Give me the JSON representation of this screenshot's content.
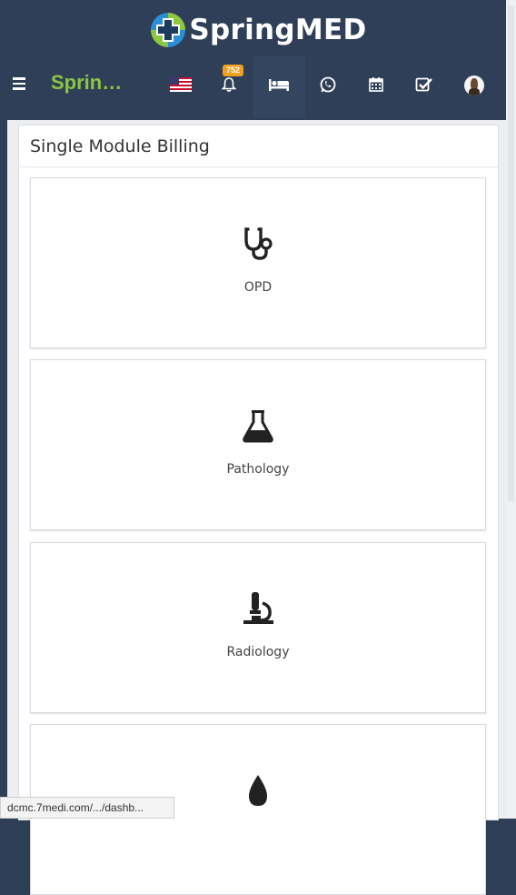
{
  "header": {
    "logo_text": "SpringMED",
    "brand_short": "Sprin…",
    "notification_count": "752",
    "icons": [
      "us-flag-icon",
      "bell-icon",
      "bed-icon",
      "whatsapp-icon",
      "calendar-icon",
      "check-square-icon",
      "user-avatar"
    ]
  },
  "panel": {
    "title": "Single Module Billing"
  },
  "modules": [
    {
      "label": "OPD",
      "icon": "stethoscope-icon"
    },
    {
      "label": "Pathology",
      "icon": "flask-icon"
    },
    {
      "label": "Radiology",
      "icon": "microscope-icon"
    },
    {
      "label": "",
      "icon": "blood-drop-icon"
    }
  ],
  "status_bar": {
    "url": "dcmc.7medi.com/.../dashb..."
  },
  "colors": {
    "header_bg": "#2e3f57",
    "brand_green": "#8dc63f",
    "badge_orange": "#f0a01e"
  }
}
